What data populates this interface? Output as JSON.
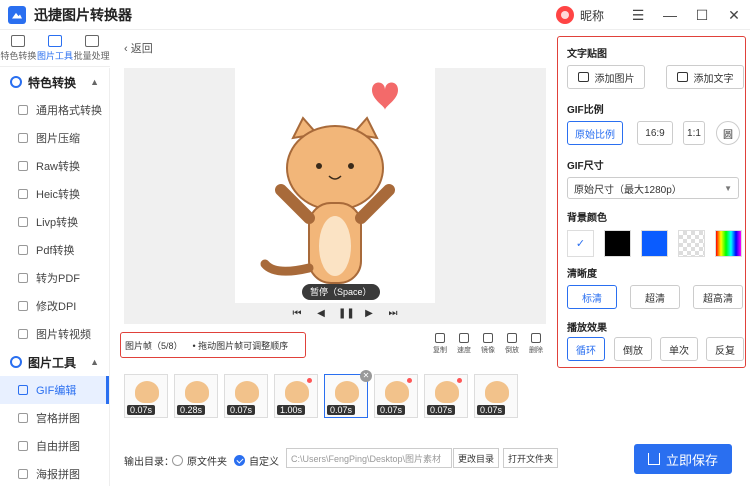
{
  "app": {
    "title": "迅捷图片转换器",
    "nickname": "昵称"
  },
  "window_controls": [
    "☰",
    "—",
    "☐",
    "✕"
  ],
  "nav_tabs": [
    {
      "label": "特色转换"
    },
    {
      "label": "图片工具"
    },
    {
      "label": "批量处理"
    }
  ],
  "sidebar": {
    "group1": "特色转换",
    "group1_items": [
      "通用格式转换",
      "图片压缩",
      "Raw转换",
      "Heic转换",
      "Livp转换",
      "Pdf转换",
      "转为PDF",
      "修改DPI",
      "图片转视频"
    ],
    "group2": "图片工具",
    "group2_items": [
      "GIF编辑",
      "宫格拼图",
      "自由拼图",
      "海报拼图"
    ]
  },
  "back_label": "返回",
  "pause_tip": "暂停（Space）",
  "frame_info": {
    "label": "图片帧（5/8）",
    "hint": "• 拖动图片帧可调整顺序"
  },
  "tools": [
    "复制",
    "速度",
    "镜像",
    "倒放",
    "删除"
  ],
  "frames": [
    "0.07s",
    "0.28s",
    "0.07s",
    "1.00s",
    "0.07s",
    "0.07s",
    "0.07s",
    "0.07s"
  ],
  "output": {
    "label": "输出目录：",
    "opt_original": "原文件夹",
    "opt_custom": "自定义",
    "path": "C:\\Users\\FengPing\\Desktop\\图片素材",
    "change_btn": "更改目录",
    "open_btn": "打开文件夹",
    "save_btn": "立即保存"
  },
  "panel": {
    "text_sticker": {
      "title": "文字贴图",
      "add_image": "添加图片",
      "add_text": "添加文字"
    },
    "ratio": {
      "title": "GIF比例",
      "options": [
        "原始比例",
        "16:9",
        "1:1",
        "圆"
      ]
    },
    "size": {
      "title": "GIF尺寸",
      "value": "原始尺寸（最大1280p）"
    },
    "bg": {
      "title": "背景颜色",
      "colors": [
        "#ffffff",
        "#000000",
        "#0a5cff"
      ]
    },
    "clarity": {
      "title": "清晰度",
      "options": [
        "标清",
        "超清",
        "超高清"
      ]
    },
    "playback": {
      "title": "播放效果",
      "options": [
        "循环",
        "倒放",
        "单次",
        "反复"
      ]
    }
  },
  "colors": {
    "accent": "#2a6ff0",
    "highlight_border": "#e0413a"
  }
}
